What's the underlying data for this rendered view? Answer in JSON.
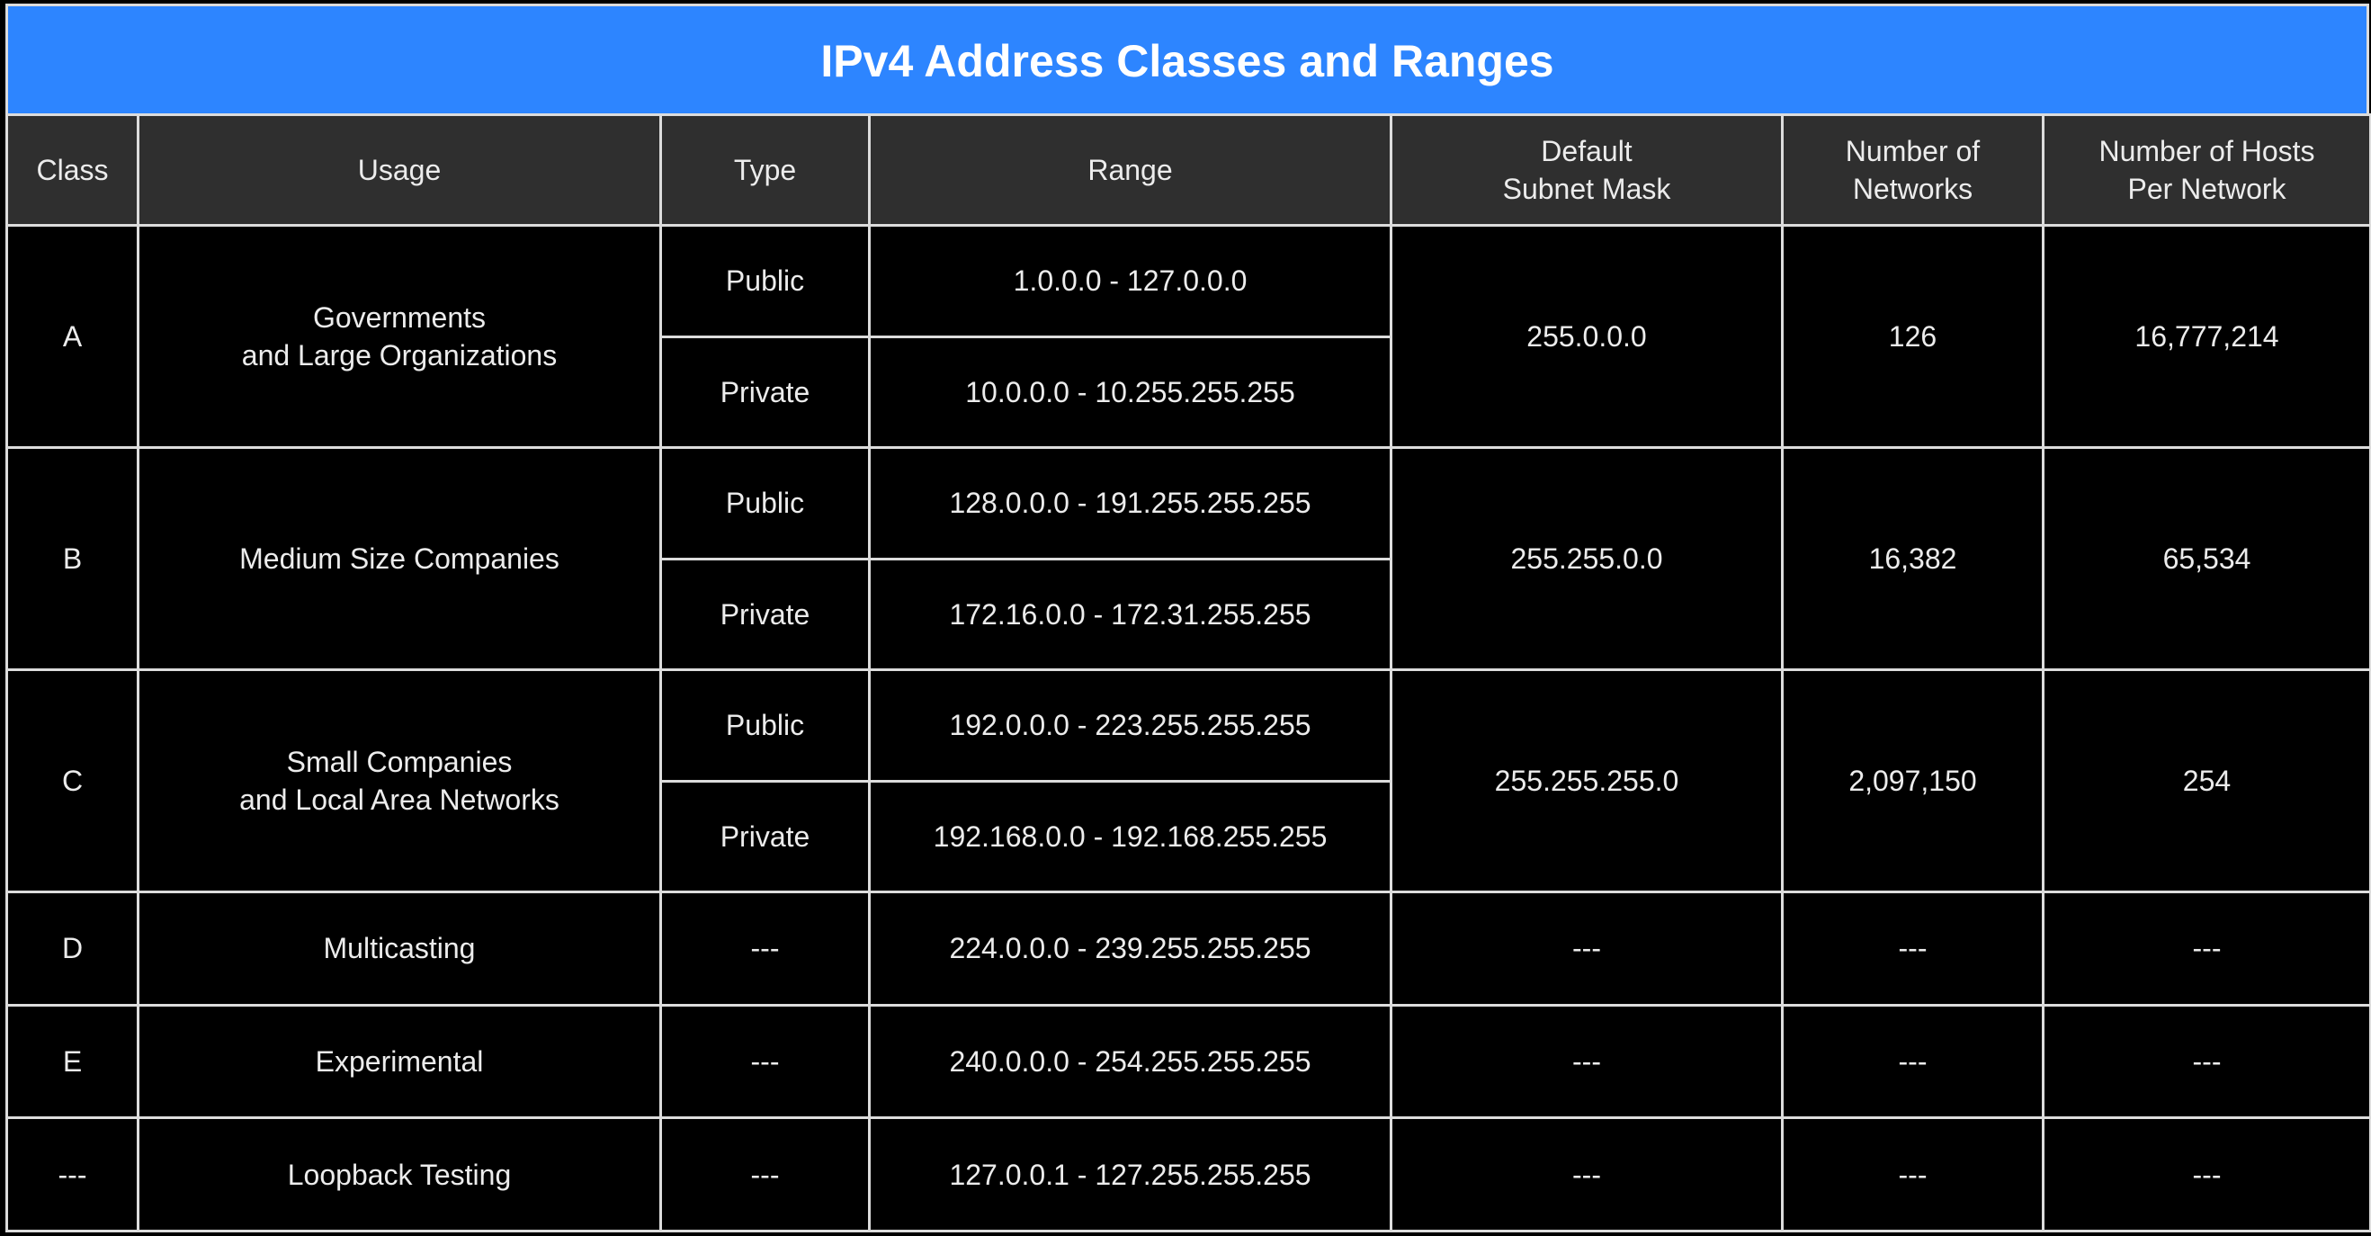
{
  "title": "IPv4 Address Classes and Ranges",
  "colors": {
    "title_background": "#2d85ff",
    "header_background": "#2f2f2f",
    "public": "#ff1453",
    "private": "#2fc25b",
    "special": "#2f88ff"
  },
  "columns": [
    "Class",
    "Usage",
    "Type",
    "Range",
    "Default\nSubnet Mask",
    "Number of\nNetworks",
    "Number of Hosts\nPer Network"
  ],
  "rows": [
    {
      "class": "A",
      "usage": "Governments\nand Large Organizations",
      "public": {
        "type": "Public",
        "range": "1.0.0.0 - 127.0.0.0"
      },
      "private": {
        "type": "Private",
        "range": "10.0.0.0 - 10.255.255.255"
      },
      "subnet_mask": "255.0.0.0",
      "networks": "126",
      "hosts": "16,777,214"
    },
    {
      "class": "B",
      "usage": "Medium Size Companies",
      "public": {
        "type": "Public",
        "range": "128.0.0.0 - 191.255.255.255"
      },
      "private": {
        "type": "Private",
        "range": "172.16.0.0 - 172.31.255.255"
      },
      "subnet_mask": "255.255.0.0",
      "networks": "16,382",
      "hosts": "65,534"
    },
    {
      "class": "C",
      "usage": "Small Companies\nand Local Area Networks",
      "public": {
        "type": "Public",
        "range": "192.0.0.0 - 223.255.255.255"
      },
      "private": {
        "type": "Private",
        "range": "192.168.0.0 - 192.168.255.255"
      },
      "subnet_mask": "255.255.255.0",
      "networks": "2,097,150",
      "hosts": "254"
    },
    {
      "class": "D",
      "usage": "Multicasting",
      "type": "---",
      "range": "224.0.0.0 - 239.255.255.255",
      "subnet_mask": "---",
      "networks": "---",
      "hosts": "---"
    },
    {
      "class": "E",
      "usage": "Experimental",
      "type": "---",
      "range": "240.0.0.0 - 254.255.255.255",
      "subnet_mask": "---",
      "networks": "---",
      "hosts": "---"
    },
    {
      "class": "---",
      "usage": "Loopback Testing",
      "type": "---",
      "range": "127.0.0.1 - 127.255.255.255",
      "subnet_mask": "---",
      "networks": "---",
      "hosts": "---"
    }
  ]
}
